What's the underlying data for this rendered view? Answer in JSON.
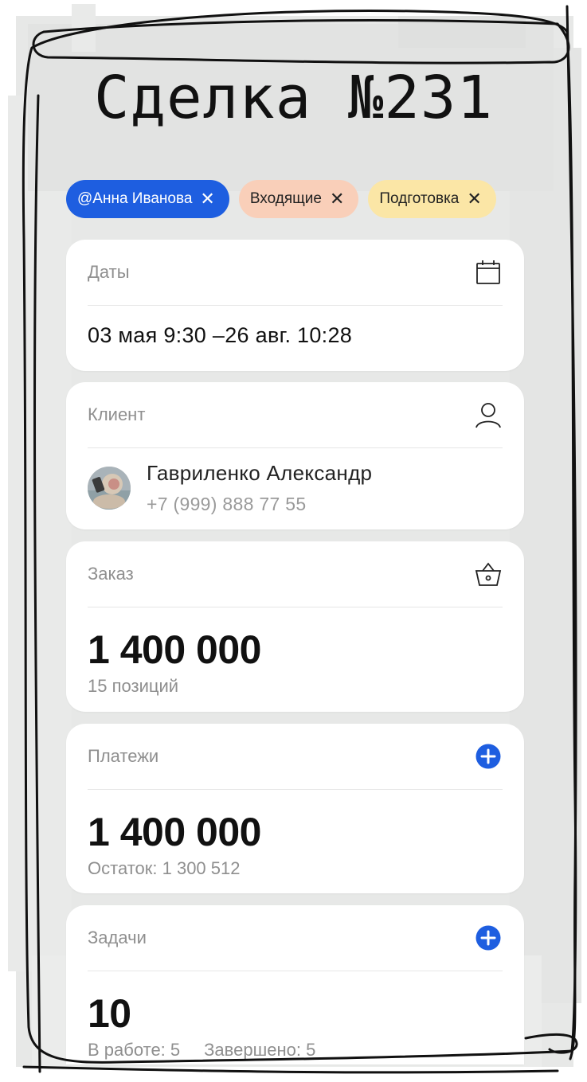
{
  "title": "Сделка №231",
  "tags": [
    {
      "label": "@Анна Иванова",
      "close": "✕"
    },
    {
      "label": "Входящие",
      "close": "✕"
    },
    {
      "label": "Подготовка",
      "close": "✕"
    }
  ],
  "dates": {
    "label": "Даты",
    "value": "03 мая 9:30 –26 авг. 10:28",
    "icon": "calendar-icon"
  },
  "client": {
    "label": "Клиент",
    "name": "Гавриленко Александр",
    "phone": "+7 (999) 888 77 55",
    "icon": "person-icon"
  },
  "order": {
    "label": "Заказ",
    "amount": "1 400 000",
    "positions": "15 позиций",
    "icon": "basket-icon"
  },
  "payments": {
    "label": "Платежи",
    "amount": "1 400 000",
    "remainder": "Остаток: 1 300 512",
    "icon": "plus-circle-icon"
  },
  "tasks": {
    "label": "Задачи",
    "count": "10",
    "in_progress": "В работе: 5",
    "done": "Завершено: 5",
    "icon": "plus-circle-icon"
  },
  "colors": {
    "accent": "#1e5ee0",
    "chip_peach": "#f9cfb9",
    "chip_yellow": "#fbe6a6",
    "background": "#e6e7e6"
  }
}
